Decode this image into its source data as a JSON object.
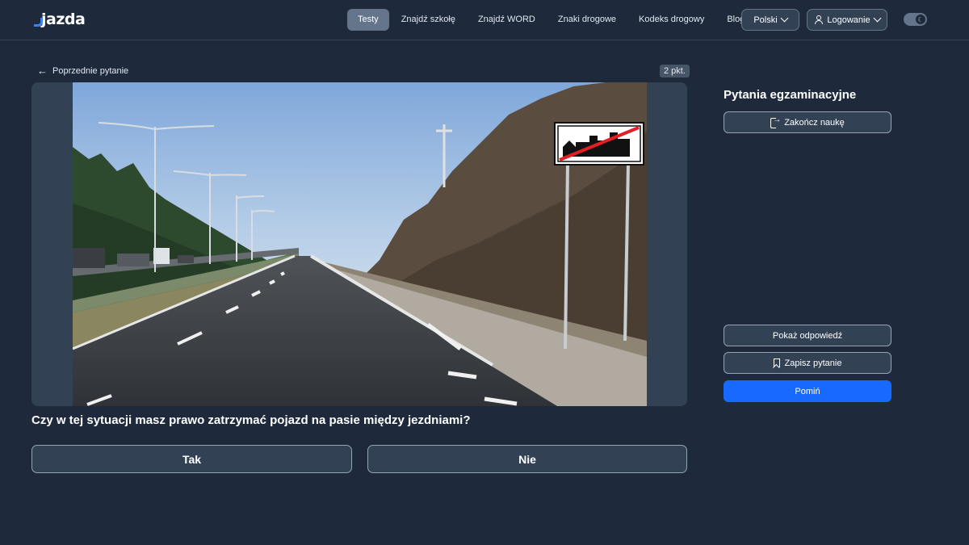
{
  "header": {
    "logo": "jazda",
    "nav": [
      "Testy",
      "Znajdź szkołę",
      "Znajdź WORD",
      "Znaki drogowe",
      "Kodeks drogowy",
      "Blog"
    ],
    "language": "Polski",
    "login": "Logowanie"
  },
  "question": {
    "prev_label": "Poprzednie pytanie",
    "points": "2 pkt.",
    "text": "Czy w tej sytuacji masz prawo zatrzymać pojazd na pasie między jezdniami?",
    "answers": [
      "Tak",
      "Nie"
    ]
  },
  "sidebar": {
    "title": "Pytania egzaminacyjne",
    "end_label": "Zakończ naukę",
    "show_answer": "Pokaż odpowiedź",
    "save_question": "Zapisz pytanie",
    "skip": "Pomiń"
  },
  "colors": {
    "background": "#1e293b",
    "card": "#334155",
    "primary": "#1769ff",
    "active_nav": "#64748b"
  }
}
